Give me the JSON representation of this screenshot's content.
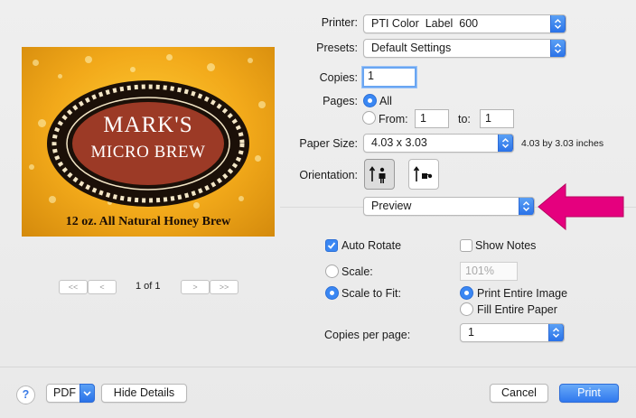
{
  "printer": {
    "label": "Printer:",
    "value": "PTI Color  Label  600"
  },
  "presets": {
    "label": "Presets:",
    "value": "Default Settings"
  },
  "copies": {
    "label": "Copies:",
    "value": "1"
  },
  "pages": {
    "label": "Pages:",
    "all_label": "All",
    "from_label": "From:",
    "from_value": "1",
    "to_label": "to:",
    "to_value": "1"
  },
  "paper_size": {
    "label": "Paper Size:",
    "value": "4.03 x 3.03",
    "description": "4.03 by 3.03 inches"
  },
  "orientation": {
    "label": "Orientation:"
  },
  "section_popup": {
    "value": "Preview"
  },
  "options": {
    "auto_rotate": "Auto Rotate",
    "show_notes": "Show Notes",
    "scale_label": "Scale:",
    "scale_value": "101%",
    "scale_to_fit": "Scale to Fit:",
    "print_entire_image": "Print Entire Image",
    "fill_entire_paper": "Fill Entire Paper",
    "copies_per_page_label": "Copies per page:",
    "copies_per_page_value": "1"
  },
  "preview": {
    "title_line1": "MARK'S",
    "title_line2": "MICRO BREW",
    "tagline": "12 oz. All Natural Honey Brew",
    "page_indicator": "1 of 1",
    "nav_first": "<<",
    "nav_prev": "<",
    "nav_next": ">",
    "nav_last": ">>"
  },
  "footer": {
    "help": "?",
    "pdf": "PDF",
    "hide_details": "Hide Details",
    "cancel": "Cancel",
    "print": "Print"
  },
  "colors": {
    "accent": "#2f78ee",
    "annotation_arrow": "#e5007e",
    "label_gold": "#f2a91a",
    "label_oval": "#9c3a26"
  },
  "icons": [
    "chevron-updown-icon",
    "portrait-orientation-icon",
    "landscape-orientation-icon",
    "dropdown-arrow-icon",
    "annotation-arrow"
  ]
}
